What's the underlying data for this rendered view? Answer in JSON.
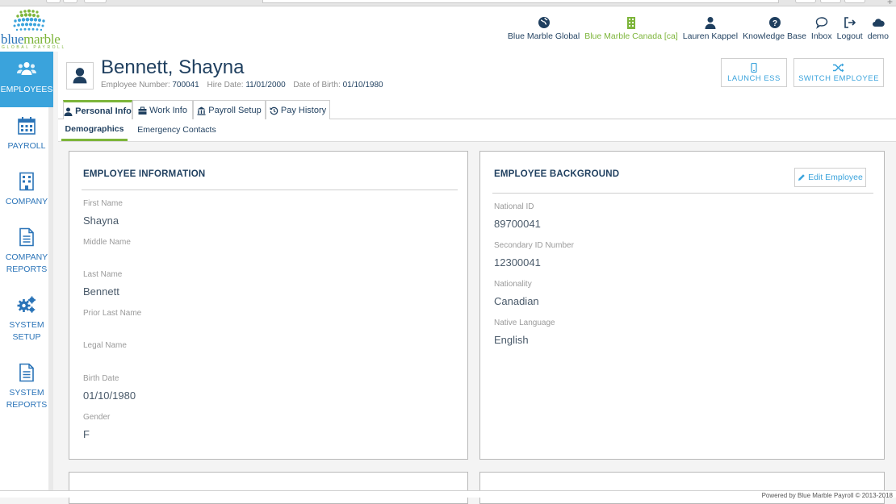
{
  "logo": {
    "brand_blue": "blue",
    "brand_green": "marble",
    "tagline": "GLOBAL PAYROLL"
  },
  "topnav": [
    {
      "label": "Blue Marble Global",
      "icon": "globe-icon"
    },
    {
      "label": "Blue Marble Canada [ca]",
      "icon": "building-icon"
    },
    {
      "label": "Lauren Kappel",
      "icon": "user-icon"
    },
    {
      "label": "Knowledge Base",
      "icon": "question-icon"
    },
    {
      "label": "Inbox",
      "icon": "chat-icon"
    },
    {
      "label": "Logout",
      "icon": "logout-icon"
    },
    {
      "label": "demo",
      "icon": "cloud-icon"
    }
  ],
  "sidebar": {
    "items": [
      {
        "label": "EMPLOYEES",
        "icon": "users-icon",
        "active": true
      },
      {
        "label": "PAYROLL",
        "icon": "calendar-icon"
      },
      {
        "label": "COMPANY",
        "icon": "building-icon"
      },
      {
        "label_l1": "COMPANY",
        "label_l2": "REPORTS",
        "icon": "document-icon"
      },
      {
        "label_l1": "SYSTEM",
        "label_l2": "SETUP",
        "icon": "gears-icon"
      },
      {
        "label_l1": "SYSTEM",
        "label_l2": "REPORTS",
        "icon": "document-icon"
      }
    ]
  },
  "employee": {
    "name": "Bennett, Shayna",
    "number_label": "Employee Number:",
    "number": "700041",
    "hire_label": "Hire Date:",
    "hire": "11/01/2000",
    "dob_label": "Date of Birth:",
    "dob": "01/10/1980"
  },
  "actions": {
    "launch_ess": "LAUNCH ESS",
    "switch_employee": "SWITCH EMPLOYEE"
  },
  "tabs": [
    "Personal Info",
    "Work Info",
    "Payroll Setup",
    "Pay History"
  ],
  "subtabs": [
    "Demographics",
    "Emergency Contacts"
  ],
  "employee_info": {
    "title": "EMPLOYEE INFORMATION",
    "fields": [
      {
        "label": "First Name",
        "value": "Shayna"
      },
      {
        "label": "Middle Name",
        "value": ""
      },
      {
        "label": "Last Name",
        "value": "Bennett"
      },
      {
        "label": "Prior Last Name",
        "value": ""
      },
      {
        "label": "Legal Name",
        "value": ""
      },
      {
        "label": "Birth Date",
        "value": "01/10/1980"
      },
      {
        "label": "Gender",
        "value": "F"
      }
    ]
  },
  "employee_background": {
    "title": "EMPLOYEE BACKGROUND",
    "edit_label": "Edit Employee",
    "fields": [
      {
        "label": "National ID",
        "value": "89700041"
      },
      {
        "label": "Secondary ID Number",
        "value": "12300041"
      },
      {
        "label": "Nationality",
        "value": "Canadian"
      },
      {
        "label": "Native Language",
        "value": "English"
      }
    ]
  },
  "footer": {
    "text": "Powered by Blue Marble Payroll © 2013-2018"
  },
  "colors": {
    "accent": "#3aa3dc",
    "brand_green": "#7db53a",
    "navy": "#1f3f5f"
  }
}
